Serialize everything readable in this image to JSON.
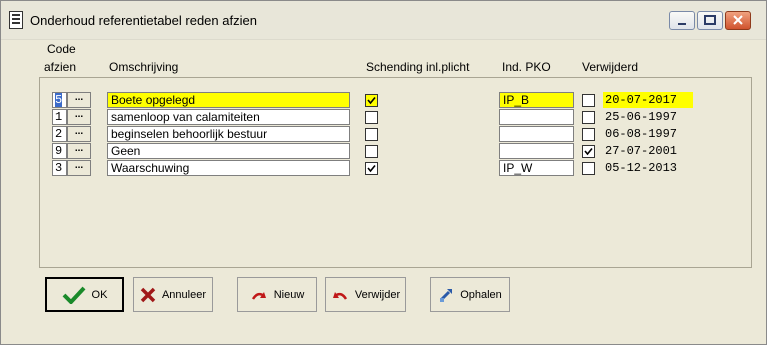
{
  "window": {
    "title": "Onderhoud referentietabel reden afzien"
  },
  "columns": {
    "code_line1": "Code",
    "code_line2": "afzien",
    "omschrijving": "Omschrijving",
    "schending": "Schending inl.plicht",
    "ind_pko": "Ind. PKO",
    "verwijderd": "Verwijderd"
  },
  "lookup_label": "...",
  "rows": [
    {
      "code": "5",
      "omschrijving": "Boete opgelegd",
      "schending": true,
      "ind_pko": "IP_B",
      "verwijderd": false,
      "datum": "20-07-2017",
      "selected": true
    },
    {
      "code": "1",
      "omschrijving": "samenloop van calamiteiten",
      "schending": false,
      "ind_pko": "",
      "verwijderd": false,
      "datum": "25-06-1997",
      "selected": false
    },
    {
      "code": "2",
      "omschrijving": "beginselen behoorlijk bestuur",
      "schending": false,
      "ind_pko": "",
      "verwijderd": false,
      "datum": "06-08-1997",
      "selected": false
    },
    {
      "code": "9",
      "omschrijving": "Geen",
      "schending": false,
      "ind_pko": "",
      "verwijderd": true,
      "datum": "27-07-2001",
      "selected": false
    },
    {
      "code": "3",
      "omschrijving": "Waarschuwing",
      "schending": true,
      "ind_pko": "IP_W",
      "verwijderd": false,
      "datum": "05-12-2013",
      "selected": false
    }
  ],
  "buttons": {
    "ok": "OK",
    "annuleer": "Annuleer",
    "nieuw": "Nieuw",
    "verwijder": "Verwijder",
    "ophalen": "Ophalen"
  },
  "colors": {
    "highlight": "#FFFF00",
    "face": "#ECE9D8",
    "check": "#000000"
  }
}
